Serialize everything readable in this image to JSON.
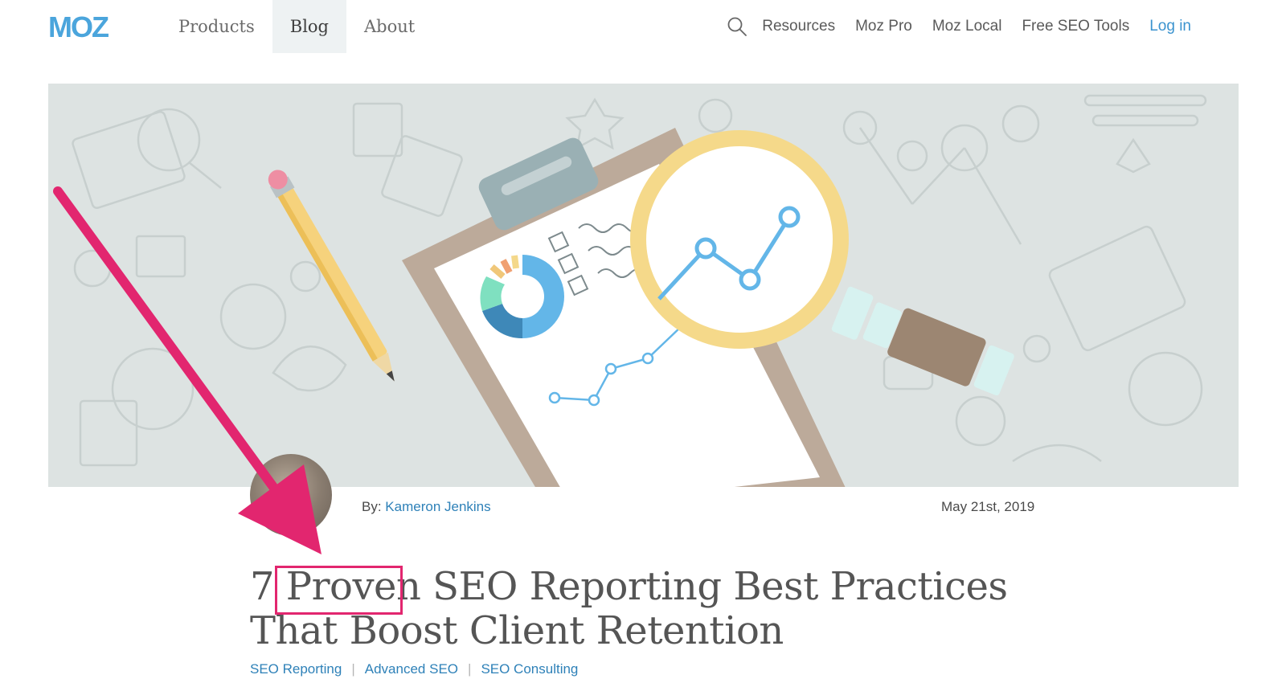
{
  "header": {
    "logo_text": "MOZ",
    "nav_left": [
      {
        "label": "Products",
        "active": false
      },
      {
        "label": "Blog",
        "active": true
      },
      {
        "label": "About",
        "active": false
      }
    ],
    "search_icon": "search-icon",
    "nav_right": [
      "Resources",
      "Moz Pro",
      "Moz Local",
      "Free SEO Tools"
    ],
    "login_label": "Log in"
  },
  "post": {
    "by_label": "By:",
    "author": "Kameron Jenkins",
    "date": "May 21st, 2019",
    "title": "7 Proven SEO Reporting Best Practices That Boost Client Retention",
    "tags": [
      "SEO Reporting",
      "Advanced SEO",
      "SEO Consulting"
    ],
    "tag_separator": "|"
  },
  "colors": {
    "brand_blue": "#4ba5dc",
    "link_blue": "#2e81b8",
    "annotation_pink": "#e2266f",
    "hero_bg": "#dde3e2"
  }
}
